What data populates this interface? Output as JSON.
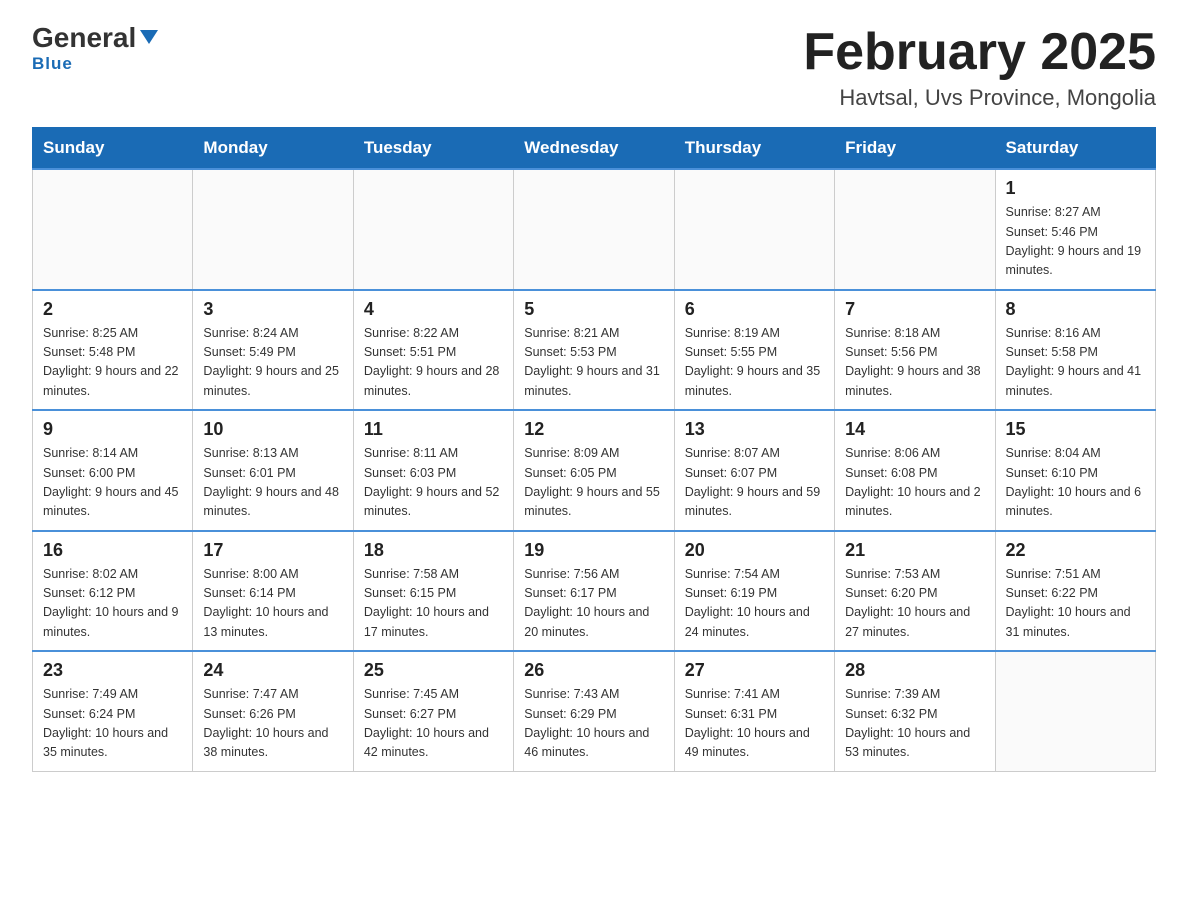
{
  "header": {
    "logo_general": "General",
    "logo_blue": "Blue",
    "title": "February 2025",
    "subtitle": "Havtsal, Uvs Province, Mongolia"
  },
  "calendar": {
    "weekdays": [
      "Sunday",
      "Monday",
      "Tuesday",
      "Wednesday",
      "Thursday",
      "Friday",
      "Saturday"
    ],
    "weeks": [
      {
        "days": [
          {
            "date": "",
            "info": ""
          },
          {
            "date": "",
            "info": ""
          },
          {
            "date": "",
            "info": ""
          },
          {
            "date": "",
            "info": ""
          },
          {
            "date": "",
            "info": ""
          },
          {
            "date": "",
            "info": ""
          },
          {
            "date": "1",
            "info": "Sunrise: 8:27 AM\nSunset: 5:46 PM\nDaylight: 9 hours and 19 minutes."
          }
        ]
      },
      {
        "days": [
          {
            "date": "2",
            "info": "Sunrise: 8:25 AM\nSunset: 5:48 PM\nDaylight: 9 hours and 22 minutes."
          },
          {
            "date": "3",
            "info": "Sunrise: 8:24 AM\nSunset: 5:49 PM\nDaylight: 9 hours and 25 minutes."
          },
          {
            "date": "4",
            "info": "Sunrise: 8:22 AM\nSunset: 5:51 PM\nDaylight: 9 hours and 28 minutes."
          },
          {
            "date": "5",
            "info": "Sunrise: 8:21 AM\nSunset: 5:53 PM\nDaylight: 9 hours and 31 minutes."
          },
          {
            "date": "6",
            "info": "Sunrise: 8:19 AM\nSunset: 5:55 PM\nDaylight: 9 hours and 35 minutes."
          },
          {
            "date": "7",
            "info": "Sunrise: 8:18 AM\nSunset: 5:56 PM\nDaylight: 9 hours and 38 minutes."
          },
          {
            "date": "8",
            "info": "Sunrise: 8:16 AM\nSunset: 5:58 PM\nDaylight: 9 hours and 41 minutes."
          }
        ]
      },
      {
        "days": [
          {
            "date": "9",
            "info": "Sunrise: 8:14 AM\nSunset: 6:00 PM\nDaylight: 9 hours and 45 minutes."
          },
          {
            "date": "10",
            "info": "Sunrise: 8:13 AM\nSunset: 6:01 PM\nDaylight: 9 hours and 48 minutes."
          },
          {
            "date": "11",
            "info": "Sunrise: 8:11 AM\nSunset: 6:03 PM\nDaylight: 9 hours and 52 minutes."
          },
          {
            "date": "12",
            "info": "Sunrise: 8:09 AM\nSunset: 6:05 PM\nDaylight: 9 hours and 55 minutes."
          },
          {
            "date": "13",
            "info": "Sunrise: 8:07 AM\nSunset: 6:07 PM\nDaylight: 9 hours and 59 minutes."
          },
          {
            "date": "14",
            "info": "Sunrise: 8:06 AM\nSunset: 6:08 PM\nDaylight: 10 hours and 2 minutes."
          },
          {
            "date": "15",
            "info": "Sunrise: 8:04 AM\nSunset: 6:10 PM\nDaylight: 10 hours and 6 minutes."
          }
        ]
      },
      {
        "days": [
          {
            "date": "16",
            "info": "Sunrise: 8:02 AM\nSunset: 6:12 PM\nDaylight: 10 hours and 9 minutes."
          },
          {
            "date": "17",
            "info": "Sunrise: 8:00 AM\nSunset: 6:14 PM\nDaylight: 10 hours and 13 minutes."
          },
          {
            "date": "18",
            "info": "Sunrise: 7:58 AM\nSunset: 6:15 PM\nDaylight: 10 hours and 17 minutes."
          },
          {
            "date": "19",
            "info": "Sunrise: 7:56 AM\nSunset: 6:17 PM\nDaylight: 10 hours and 20 minutes."
          },
          {
            "date": "20",
            "info": "Sunrise: 7:54 AM\nSunset: 6:19 PM\nDaylight: 10 hours and 24 minutes."
          },
          {
            "date": "21",
            "info": "Sunrise: 7:53 AM\nSunset: 6:20 PM\nDaylight: 10 hours and 27 minutes."
          },
          {
            "date": "22",
            "info": "Sunrise: 7:51 AM\nSunset: 6:22 PM\nDaylight: 10 hours and 31 minutes."
          }
        ]
      },
      {
        "days": [
          {
            "date": "23",
            "info": "Sunrise: 7:49 AM\nSunset: 6:24 PM\nDaylight: 10 hours and 35 minutes."
          },
          {
            "date": "24",
            "info": "Sunrise: 7:47 AM\nSunset: 6:26 PM\nDaylight: 10 hours and 38 minutes."
          },
          {
            "date": "25",
            "info": "Sunrise: 7:45 AM\nSunset: 6:27 PM\nDaylight: 10 hours and 42 minutes."
          },
          {
            "date": "26",
            "info": "Sunrise: 7:43 AM\nSunset: 6:29 PM\nDaylight: 10 hours and 46 minutes."
          },
          {
            "date": "27",
            "info": "Sunrise: 7:41 AM\nSunset: 6:31 PM\nDaylight: 10 hours and 49 minutes."
          },
          {
            "date": "28",
            "info": "Sunrise: 7:39 AM\nSunset: 6:32 PM\nDaylight: 10 hours and 53 minutes."
          },
          {
            "date": "",
            "info": ""
          }
        ]
      }
    ]
  }
}
